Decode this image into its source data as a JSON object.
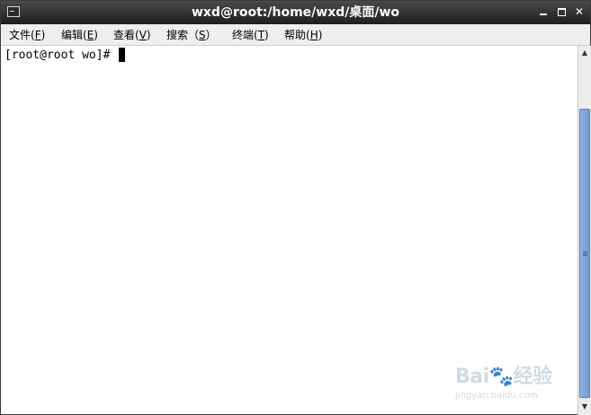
{
  "window": {
    "title": "wxd@root:/home/wxd/桌面/wo"
  },
  "menu": {
    "items": [
      {
        "label_pre": "文件(",
        "mnemonic": "F",
        "label_post": ")"
      },
      {
        "label_pre": "编辑(",
        "mnemonic": "E",
        "label_post": ")"
      },
      {
        "label_pre": "查看(",
        "mnemonic": "V",
        "label_post": ")"
      },
      {
        "label_pre": "搜索（",
        "mnemonic": "S",
        "label_post": "）"
      },
      {
        "label_pre": "终端(",
        "mnemonic": "T",
        "label_post": ")"
      },
      {
        "label_pre": "帮助(",
        "mnemonic": "H",
        "label_post": ")"
      }
    ]
  },
  "terminal": {
    "prompt": "[root@root wo]# "
  },
  "watermark": {
    "logo": "Bai🐾经验",
    "sub": "jingyan.baidu.com"
  },
  "icons": {
    "window_icon": "terminal-icon",
    "minimize": "minimize-icon",
    "maximize": "maximize-icon",
    "close": "close-icon"
  },
  "colors": {
    "titlebar": "#2b2b2b",
    "menubar": "#eeeeee",
    "scroll_thumb": "#7aa6d8"
  }
}
